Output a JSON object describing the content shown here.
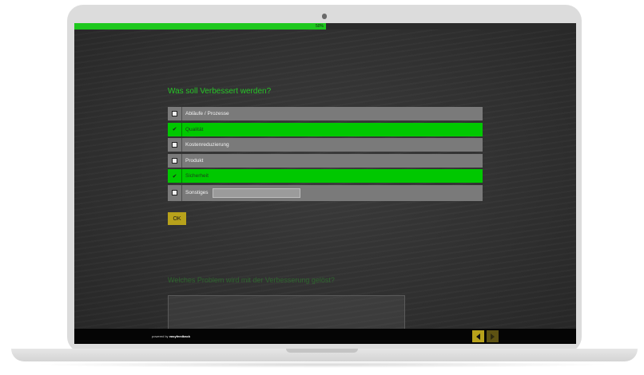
{
  "progress": {
    "percent": 50,
    "label": "50%"
  },
  "question": {
    "title": "Was soll Verbessert werden?"
  },
  "options": [
    {
      "label": "Abläufe / Prozesse",
      "checked": false
    },
    {
      "label": "Qualität",
      "checked": true
    },
    {
      "label": "Kostenreduzierung",
      "checked": false
    },
    {
      "label": "Produkt",
      "checked": false
    },
    {
      "label": "Sicherheit",
      "checked": true
    }
  ],
  "other": {
    "label": "Sonstiges",
    "value": "",
    "placeholder": ""
  },
  "ok_label": "OK",
  "next_question": {
    "title": "Welches Problem wird mit der Verbesserung gelöst?"
  },
  "footer": {
    "powered_prefix": "powered by",
    "brand": "easyfeedback"
  },
  "icons": {
    "check": "check-icon",
    "back": "arrow-left-icon",
    "forward": "arrow-right-icon"
  },
  "colors": {
    "accent": "#00c800",
    "button": "#b8a21b"
  }
}
